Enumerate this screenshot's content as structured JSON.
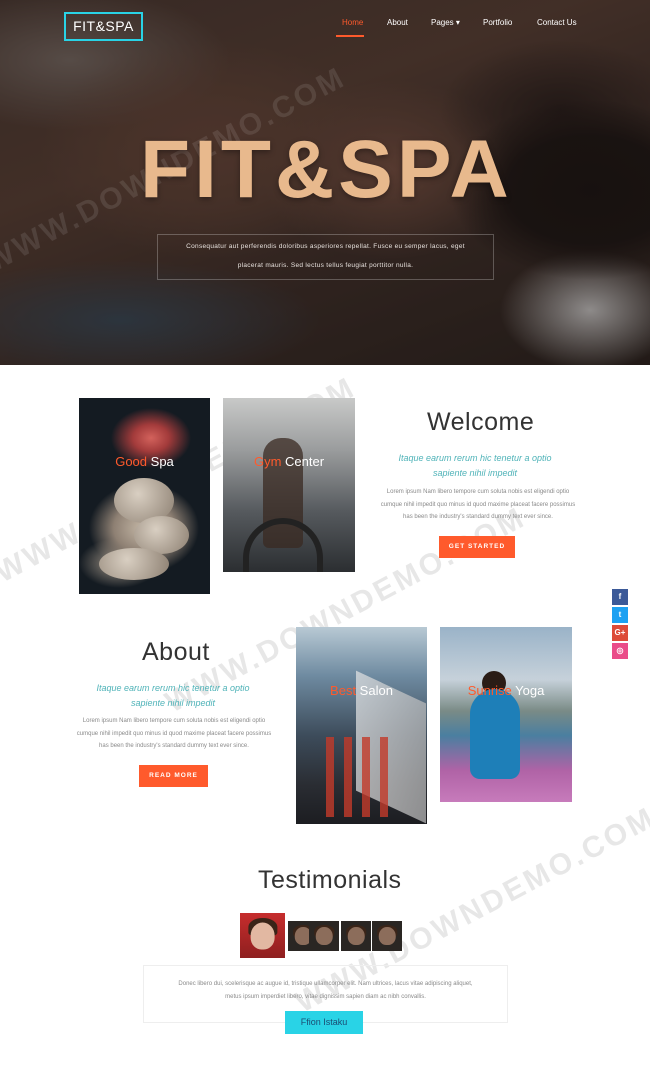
{
  "brand": {
    "logo_text": "FIT&SPA",
    "accent": "#ff5a2c",
    "cyan": "#29d3e6"
  },
  "nav": {
    "items": [
      {
        "label": "Home",
        "active": true
      },
      {
        "label": "About",
        "active": false
      },
      {
        "label": "Pages ▾",
        "active": false
      },
      {
        "label": "Portfolio",
        "active": false
      },
      {
        "label": "Contact Us",
        "active": false
      }
    ]
  },
  "hero": {
    "title": "FIT&SPA",
    "text_line1": "Consequatur aut perferendis doloribus asperiores repellat. Fusce eu semper lacus, eget",
    "text_line2": "placerat mauris. Sed lectus tellus feugiat porttitor nulla."
  },
  "services": [
    {
      "highlight": "Good",
      "rest": " Spa"
    },
    {
      "highlight": "Gym",
      "rest": " Center"
    },
    {
      "highlight": "Best",
      "rest": " Salon"
    },
    {
      "highlight": "Sunrise",
      "rest": " Yoga"
    }
  ],
  "welcome": {
    "title": "Welcome",
    "subtitle_line1": "Itaque earum rerum hic tenetur a optio",
    "subtitle_line2": "sapiente nihil impedit",
    "body_line1": "Lorem ipsum Nam libero tempore cum soluta nobis est eligendi optio",
    "body_line2": "cumque nihil impedit quo minus id quod maxime placeat facere possimus",
    "body_line3": "has been the industry's standard dummy text ever since.",
    "button": "GET STARTED"
  },
  "about": {
    "title": "About",
    "subtitle_line1": "Itaque earum rerum hic tenetur a optio",
    "subtitle_line2": "sapiente nihil impedit",
    "body_line1": "Lorem ipsum Nam libero tempore cum soluta nobis est eligendi optio",
    "body_line2": "cumque nihil impedit quo minus id quod maxime placeat facere possimus",
    "body_line3": "has been the industry's standard dummy text ever since.",
    "button": "READ MORE"
  },
  "social": [
    {
      "icon": "facebook-icon",
      "glyph": "f",
      "color": "#3b5998"
    },
    {
      "icon": "twitter-icon",
      "glyph": "t",
      "color": "#1da1f2"
    },
    {
      "icon": "google-plus-icon",
      "glyph": "G+",
      "color": "#dd4b39"
    },
    {
      "icon": "dribbble-icon",
      "glyph": "◎",
      "color": "#ea4c89"
    }
  ],
  "testimonials": {
    "title": "Testimonials",
    "quote_line1": "Donec libero dui, scelerisque ac augue id, tristique ullamcorper elit. Nam ultrices, lacus vitae adipiscing aliquet,",
    "quote_line2": "metus ipsum imperdiet libero, vitae dignissim sapien diam ac nibh convallis.",
    "name": "Ffion Istaku"
  },
  "watermark": "WWW.DOWNDEMO.COM"
}
